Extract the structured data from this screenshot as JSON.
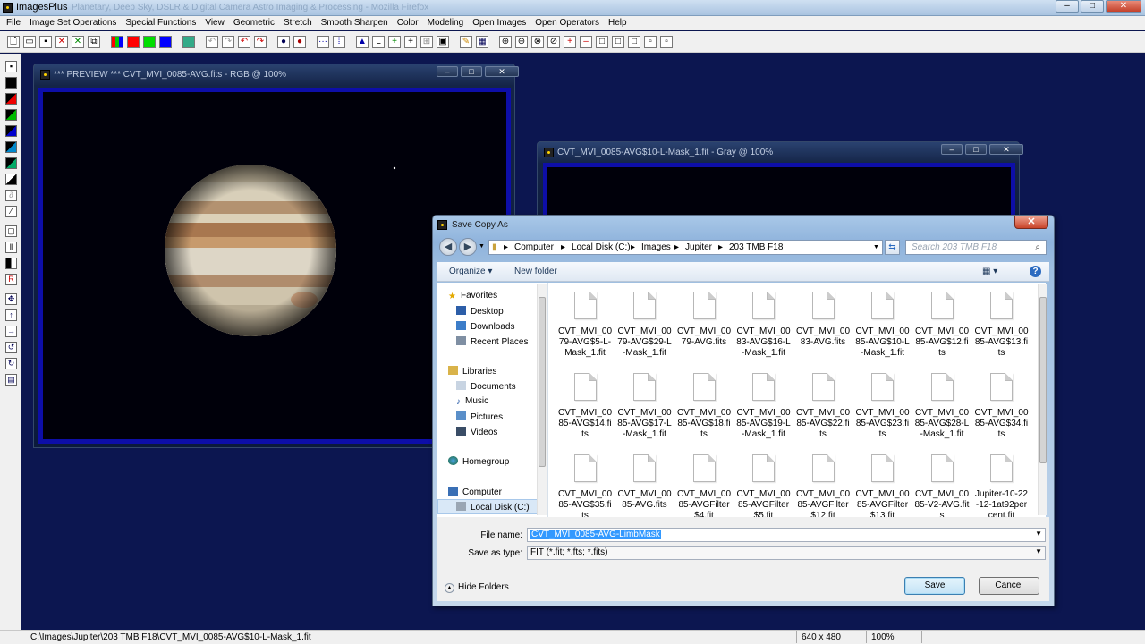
{
  "app": {
    "title": "ImagesPlus",
    "ghost_title": "Planetary, Deep Sky, DSLR & Digital Camera Astro Imaging & Processing - Mozilla Firefox"
  },
  "menu": [
    "File",
    "Image Set Operations",
    "Special Functions",
    "View",
    "Geometric",
    "Stretch",
    "Smooth Sharpen",
    "Color",
    "Modeling",
    "Open Images",
    "Open Operators",
    "Help"
  ],
  "preview_window": {
    "title": "*** PREVIEW *** CVT_MVI_0085-AVG.fits - RGB @ 100%"
  },
  "mask_window": {
    "title": "CVT_MVI_0085-AVG$10-L-Mask_1.fit - Gray @ 100%"
  },
  "dialog": {
    "title": "Save Copy As",
    "breadcrumb": [
      "Computer",
      "Local Disk (C:)",
      "Images",
      "Jupiter",
      "203 TMB F18"
    ],
    "search_placeholder": "Search 203 TMB F18",
    "organize_label": "Organize",
    "new_folder_label": "New folder",
    "nav": {
      "favorites": "Favorites",
      "favorites_items": [
        "Desktop",
        "Downloads",
        "Recent Places"
      ],
      "libraries": "Libraries",
      "libraries_items": [
        "Documents",
        "Music",
        "Pictures",
        "Videos"
      ],
      "homegroup": "Homegroup",
      "computer": "Computer",
      "computer_items": [
        "Local Disk (C:)"
      ]
    },
    "files": [
      "CVT_MVI_0079-AVG$5-L-Mask_1.fit",
      "CVT_MVI_0079-AVG$29-L-Mask_1.fit",
      "CVT_MVI_0079-AVG.fits",
      "CVT_MVI_0083-AVG$16-L-Mask_1.fit",
      "CVT_MVI_0083-AVG.fits",
      "CVT_MVI_0085-AVG$10-L-Mask_1.fit",
      "CVT_MVI_0085-AVG$12.fits",
      "CVT_MVI_0085-AVG$13.fits",
      "CVT_MVI_0085-AVG$14.fits",
      "CVT_MVI_0085-AVG$17-L-Mask_1.fit",
      "CVT_MVI_0085-AVG$18.fits",
      "CVT_MVI_0085-AVG$19-L-Mask_1.fit",
      "CVT_MVI_0085-AVG$22.fits",
      "CVT_MVI_0085-AVG$23.fits",
      "CVT_MVI_0085-AVG$28-L-Mask_1.fit",
      "CVT_MVI_0085-AVG$34.fits",
      "CVT_MVI_0085-AVG$35.fits",
      "CVT_MVI_0085-AVG.fits",
      "CVT_MVI_0085-AVGFilter$4.fit",
      "CVT_MVI_0085-AVGFilter$5.fit",
      "CVT_MVI_0085-AVGFilter$12.fit",
      "CVT_MVI_0085-AVGFilter$13.fit",
      "CVT_MVI_0085-V2-AVG.fits",
      "Jupiter-10-22-12-1at92percent.fit"
    ],
    "file_name_label": "File name:",
    "file_name_value": "CVT_MVI_0085-AVG-LimbMask",
    "save_type_label": "Save as type:",
    "save_type_value": "FIT (*.fit; *.fts; *.fits)",
    "hide_folders_label": "Hide Folders",
    "save_label": "Save",
    "cancel_label": "Cancel"
  },
  "status": {
    "path": "C:\\Images\\Jupiter\\203 TMB F18\\CVT_MVI_0085-AVG$10-L-Mask_1.fit",
    "dimensions": "640 x 480",
    "zoom": "100%"
  }
}
